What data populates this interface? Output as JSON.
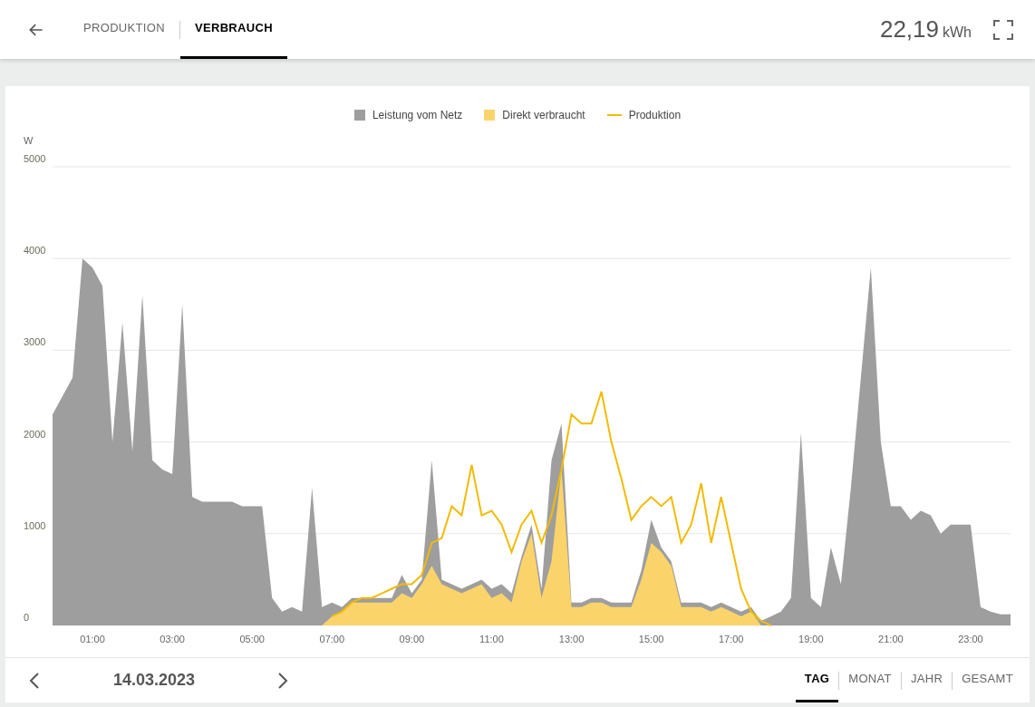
{
  "header": {
    "tabs": [
      {
        "label": "PRODUKTION",
        "selected": false
      },
      {
        "label": "VERBRAUCH",
        "selected": true
      }
    ],
    "total": "22,19",
    "unit": "kWh"
  },
  "chart": {
    "chart_data": {
      "type": "area",
      "ylabel": "W",
      "grid": true,
      "xlim": [
        0,
        24
      ],
      "ylim": [
        0,
        5000
      ],
      "yticks": [
        0,
        1000,
        2000,
        3000,
        4000,
        5000
      ],
      "xticks": [
        {
          "value": 1,
          "label": "01:00"
        },
        {
          "value": 3,
          "label": "03:00"
        },
        {
          "value": 5,
          "label": "05:00"
        },
        {
          "value": 7,
          "label": "07:00"
        },
        {
          "value": 9,
          "label": "09:00"
        },
        {
          "value": 11,
          "label": "11:00"
        },
        {
          "value": 13,
          "label": "13:00"
        },
        {
          "value": 15,
          "label": "15:00"
        },
        {
          "value": 17,
          "label": "17:00"
        },
        {
          "value": 19,
          "label": "19:00"
        },
        {
          "value": 21,
          "label": "21:00"
        },
        {
          "value": 23,
          "label": "23:00"
        }
      ],
      "x": [
        0,
        0.25,
        0.5,
        0.75,
        1,
        1.25,
        1.5,
        1.75,
        2,
        2.25,
        2.5,
        2.75,
        3,
        3.25,
        3.5,
        3.75,
        4,
        4.25,
        4.5,
        4.75,
        5,
        5.25,
        5.5,
        5.75,
        6,
        6.25,
        6.5,
        6.75,
        7,
        7.25,
        7.5,
        7.75,
        8,
        8.25,
        8.5,
        8.75,
        9,
        9.25,
        9.5,
        9.75,
        10,
        10.25,
        10.5,
        10.75,
        11,
        11.25,
        11.5,
        11.75,
        12,
        12.25,
        12.5,
        12.75,
        13,
        13.25,
        13.5,
        13.75,
        14,
        14.25,
        14.5,
        14.75,
        15,
        15.25,
        15.5,
        15.75,
        16,
        16.25,
        16.5,
        16.75,
        17,
        17.25,
        17.5,
        17.75,
        18,
        18.25,
        18.5,
        18.75,
        19,
        19.25,
        19.5,
        19.75,
        20,
        20.25,
        20.5,
        20.75,
        21,
        21.25,
        21.5,
        21.75,
        22,
        22.25,
        22.5,
        22.75,
        23,
        23.25,
        23.5,
        23.75,
        24
      ],
      "series": [
        {
          "name": "Leistung vom Netz",
          "color": "#9e9e9e",
          "values": [
            2300,
            2500,
            2700,
            4000,
            3900,
            3700,
            2000,
            3300,
            1900,
            3600,
            1800,
            1700,
            1650,
            3500,
            1400,
            1350,
            1350,
            1350,
            1350,
            1300,
            1300,
            1300,
            300,
            150,
            200,
            150,
            1500,
            200,
            250,
            200,
            300,
            300,
            300,
            300,
            300,
            550,
            350,
            500,
            1800,
            500,
            450,
            400,
            450,
            500,
            400,
            450,
            350,
            750,
            1100,
            400,
            1800,
            2200,
            250,
            250,
            300,
            300,
            250,
            250,
            250,
            600,
            1150,
            850,
            700,
            250,
            250,
            250,
            200,
            250,
            200,
            150,
            200,
            50,
            100,
            150,
            300,
            2100,
            300,
            200,
            850,
            450,
            1500,
            2700,
            3900,
            2000,
            1300,
            1300,
            1150,
            1250,
            1200,
            1000,
            1100,
            1100,
            1100,
            200,
            150,
            120,
            120
          ]
        },
        {
          "name": "Direkt verbraucht",
          "color": "#fad46b",
          "values": [
            0,
            0,
            0,
            0,
            0,
            0,
            0,
            0,
            0,
            0,
            0,
            0,
            0,
            0,
            0,
            0,
            0,
            0,
            0,
            0,
            0,
            0,
            0,
            0,
            0,
            0,
            0,
            0,
            100,
            150,
            250,
            250,
            250,
            250,
            250,
            350,
            300,
            450,
            650,
            450,
            400,
            350,
            400,
            450,
            300,
            350,
            250,
            700,
            1000,
            300,
            700,
            1700,
            200,
            200,
            250,
            250,
            200,
            200,
            200,
            500,
            900,
            800,
            650,
            200,
            200,
            200,
            150,
            200,
            150,
            100,
            150,
            0,
            0,
            0,
            0,
            0,
            0,
            0,
            0,
            0,
            0,
            0,
            0,
            0,
            0,
            0,
            0,
            0,
            0,
            0,
            0,
            0,
            0,
            0,
            0,
            0,
            0
          ]
        },
        {
          "name": "Produktion",
          "type": "line",
          "color": "#f2bb05",
          "values": [
            null,
            null,
            null,
            null,
            null,
            null,
            null,
            null,
            null,
            null,
            null,
            null,
            null,
            null,
            null,
            null,
            null,
            null,
            null,
            null,
            null,
            null,
            null,
            null,
            null,
            null,
            null,
            null,
            100,
            150,
            250,
            300,
            300,
            350,
            400,
            450,
            450,
            550,
            900,
            950,
            1300,
            1200,
            1750,
            1200,
            1250,
            1100,
            800,
            1100,
            1250,
            900,
            1200,
            1700,
            2300,
            2200,
            2200,
            2550,
            2000,
            1600,
            1150,
            1300,
            1400,
            1300,
            1400,
            900,
            1100,
            1550,
            900,
            1400,
            900,
            400,
            150,
            50,
            0,
            null,
            null,
            null,
            null,
            null,
            null,
            null,
            null,
            null,
            null,
            null,
            null,
            null,
            null,
            null,
            null,
            null,
            null,
            null,
            null,
            null,
            null,
            null,
            null
          ]
        }
      ]
    }
  },
  "footer": {
    "date": "14.03.2023",
    "periods": [
      {
        "label": "TAG",
        "selected": true
      },
      {
        "label": "MONAT",
        "selected": false
      },
      {
        "label": "JAHR",
        "selected": false
      },
      {
        "label": "GESAMT",
        "selected": false
      }
    ]
  }
}
